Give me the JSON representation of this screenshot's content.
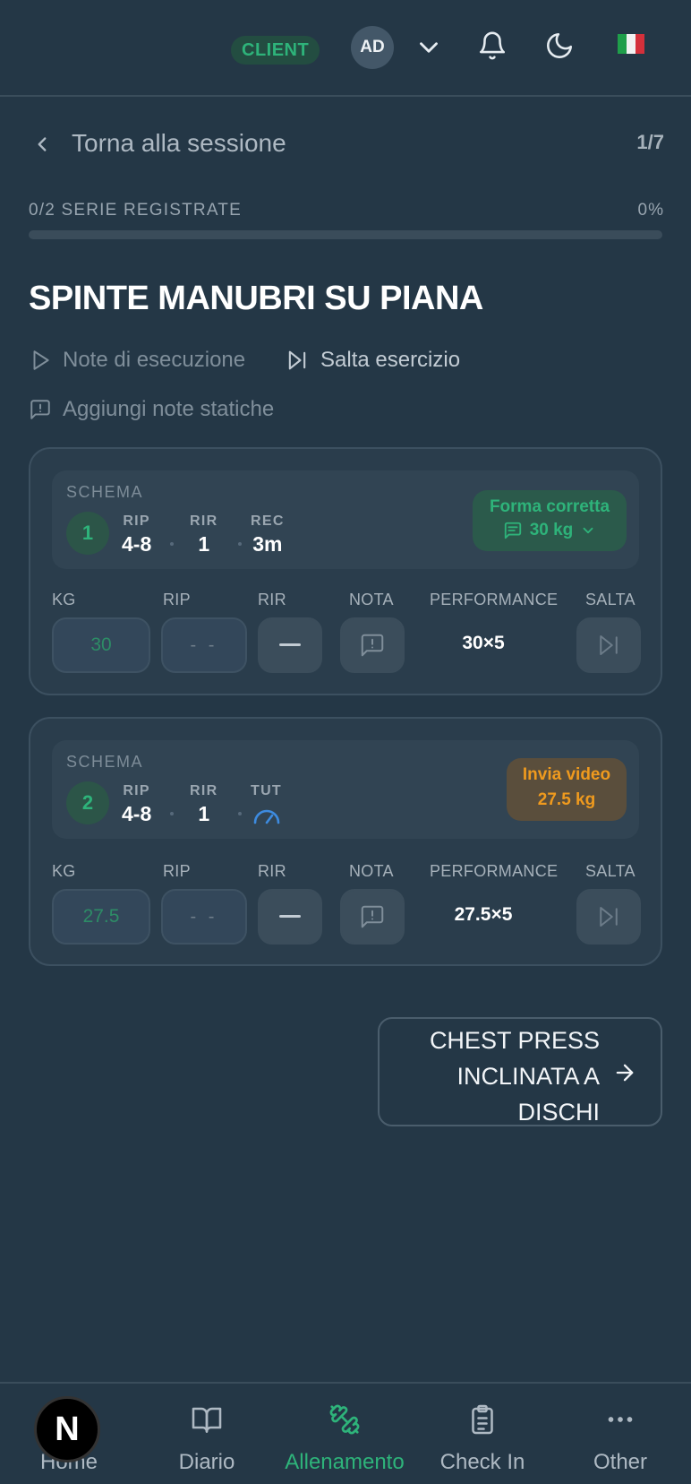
{
  "header": {
    "role_badge": "CLIENT",
    "avatar_initials": "AD",
    "flag": "🇮🇹",
    "icons": [
      "chevron-down-icon",
      "bell-icon",
      "moon-icon",
      "italy-flag-icon"
    ]
  },
  "nav_back": {
    "label": "Torna alla sessione",
    "pager": "1/7"
  },
  "progress": {
    "label": "0/2 SERIE REGISTRATE",
    "percent_label": "0%",
    "value": 0
  },
  "exercise": {
    "title": "SPINTE MANUBRI SU PIANA",
    "actions": {
      "execution_notes": "Note di esecuzione",
      "skip_exercise": "Salta esercizio",
      "static_notes": "Aggiungi note statiche"
    }
  },
  "columns": {
    "kg": "KG",
    "rip": "RIP",
    "rir": "RIR",
    "nota": "NOTA",
    "performance": "PERFORMANCE",
    "salta": "SALTA"
  },
  "sets": [
    {
      "schema_label": "SCHEMA",
      "number": "1",
      "params": [
        {
          "key": "RIP",
          "value": "4-8"
        },
        {
          "key": "RIR",
          "value": "1"
        },
        {
          "key": "REC",
          "value": "3m"
        }
      ],
      "pill": {
        "title": "Forma corretta",
        "value": "30 kg"
      },
      "kg_placeholder": "30",
      "rip_placeholder": "- -",
      "performance": "30×5"
    },
    {
      "schema_label": "SCHEMA",
      "number": "2",
      "params": [
        {
          "key": "RIP",
          "value": "4-8"
        },
        {
          "key": "RIR",
          "value": "1"
        },
        {
          "key": "TUT",
          "value": ""
        }
      ],
      "pill": {
        "title": "Invia video",
        "value": "27.5 kg"
      },
      "kg_placeholder": "27.5",
      "rip_placeholder": "- -",
      "performance": "27.5×5"
    }
  ],
  "next_exercise": {
    "label": "CHEST PRESS INCLINATA A DISCHI"
  },
  "bottom_nav": [
    {
      "label": "Home",
      "icon": "home-icon"
    },
    {
      "label": "Diario",
      "icon": "book-icon"
    },
    {
      "label": "Allenamento",
      "icon": "dumbbell-icon",
      "active": true
    },
    {
      "label": "Check In",
      "icon": "clipboard-icon"
    },
    {
      "label": "Other",
      "icon": "more-icon"
    }
  ],
  "framework_badge": "N",
  "colors": {
    "background": "#243746",
    "accent_green": "#2eb37a",
    "accent_orange": "#ef9a1e",
    "tut_blue": "#3d8bdf"
  }
}
